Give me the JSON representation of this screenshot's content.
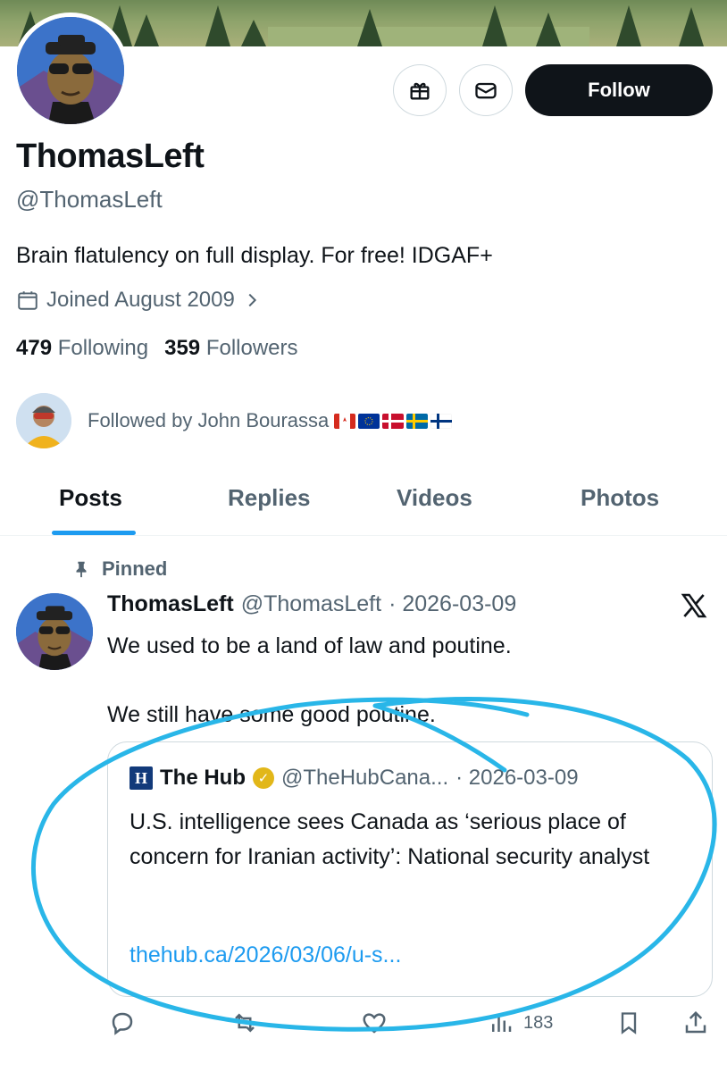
{
  "profile": {
    "name": "ThomasLeft",
    "handle": "@ThomasLeft",
    "bio": "Brain flatulency on full display. For free! IDGAF+",
    "joined": "Joined August 2009",
    "following_count": "479",
    "following_label": "Following",
    "followers_count": "359",
    "followers_label": "Followers"
  },
  "actions": {
    "follow_label": "Follow"
  },
  "followed_by": {
    "text": "Followed by John Bourassa"
  },
  "tabs": [
    {
      "label": "Posts"
    },
    {
      "label": "Replies"
    },
    {
      "label": "Videos"
    },
    {
      "label": "Photos"
    }
  ],
  "pinned_tweet": {
    "pinned_label": "Pinned",
    "author_name": "ThomasLeft",
    "author_handle": "@ThomasLeft",
    "date": "· 2026-03-09",
    "line1": "We used to be a land of law and poutine.",
    "line2": "We still have some good poutine.",
    "quote": {
      "author_name": "The Hub",
      "author_handle": "@TheHubCana...",
      "date": "· 2026-03-09",
      "text": "U.S. intelligence sees Canada as ‘serious place of concern for Iranian activity’: National security analyst",
      "link": "thehub.ca/2026/03/06/u-s..."
    },
    "views": "183"
  },
  "colors": {
    "accent": "#1d9bf0",
    "annotation": "#29b6e8",
    "text_primary": "#0f1419",
    "text_secondary": "#536471"
  },
  "icons": [
    "gift-icon",
    "envelope-icon",
    "calendar-icon",
    "chevron-right-icon",
    "pin-icon",
    "x-logo-icon",
    "reply-icon",
    "repost-icon",
    "like-icon",
    "views-icon",
    "bookmark-icon",
    "share-icon"
  ]
}
